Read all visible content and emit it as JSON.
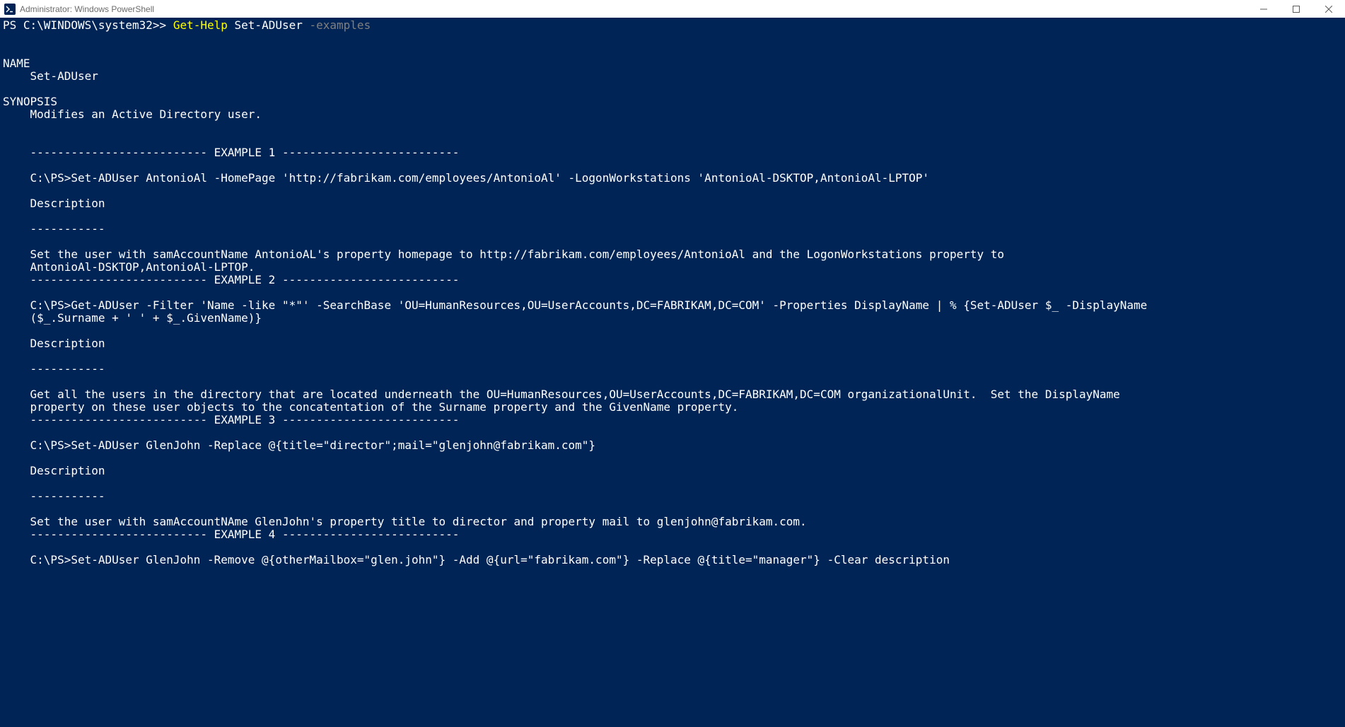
{
  "titlebar": {
    "title": "Administrator: Windows PowerShell"
  },
  "prompt": {
    "prefix": "PS C:\\WINDOWS\\system32>> ",
    "cmd_part1": "Get-Help ",
    "cmd_part2": "Set-ADUser ",
    "cmd_part3": "-examples"
  },
  "help": {
    "name_header": "NAME",
    "name_value": "    Set-ADUser",
    "synopsis_header": "SYNOPSIS",
    "synopsis_value": "    Modifies an Active Directory user.",
    "ex1_header": "    -------------------------- EXAMPLE 1 --------------------------",
    "ex1_cmd": "    C:\\PS>Set-ADUser AntonioAl -HomePage 'http://fabrikam.com/employees/AntonioAl' -LogonWorkstations 'AntonioAl-DSKTOP,AntonioAl-LPTOP'",
    "desc_label": "    Description",
    "desc_divider": "    -----------",
    "ex1_desc1": "    Set the user with samAccountName AntonioAL's property homepage to http://fabrikam.com/employees/AntonioAl and the LogonWorkstations property to",
    "ex1_desc2": "    AntonioAl-DSKTOP,AntonioAl-LPTOP.",
    "ex2_header": "    -------------------------- EXAMPLE 2 --------------------------",
    "ex2_cmd1": "    C:\\PS>Get-ADUser -Filter 'Name -like \"*\"' -SearchBase 'OU=HumanResources,OU=UserAccounts,DC=FABRIKAM,DC=COM' -Properties DisplayName | % {Set-ADUser $_ -DisplayName",
    "ex2_cmd2": "    ($_.Surname + ' ' + $_.GivenName)}",
    "ex2_desc1": "    Get all the users in the directory that are located underneath the OU=HumanResources,OU=UserAccounts,DC=FABRIKAM,DC=COM organizationalUnit.  Set the DisplayName",
    "ex2_desc2": "    property on these user objects to the concatentation of the Surname property and the GivenName property.",
    "ex3_header": "    -------------------------- EXAMPLE 3 --------------------------",
    "ex3_cmd": "    C:\\PS>Set-ADUser GlenJohn -Replace @{title=\"director\";mail=\"glenjohn@fabrikam.com\"}",
    "ex3_desc": "    Set the user with samAccountNAme GlenJohn's property title to director and property mail to glenjohn@fabrikam.com.",
    "ex4_header": "    -------------------------- EXAMPLE 4 --------------------------",
    "ex4_cmd": "    C:\\PS>Set-ADUser GlenJohn -Remove @{otherMailbox=\"glen.john\"} -Add @{url=\"fabrikam.com\"} -Replace @{title=\"manager\"} -Clear description"
  }
}
